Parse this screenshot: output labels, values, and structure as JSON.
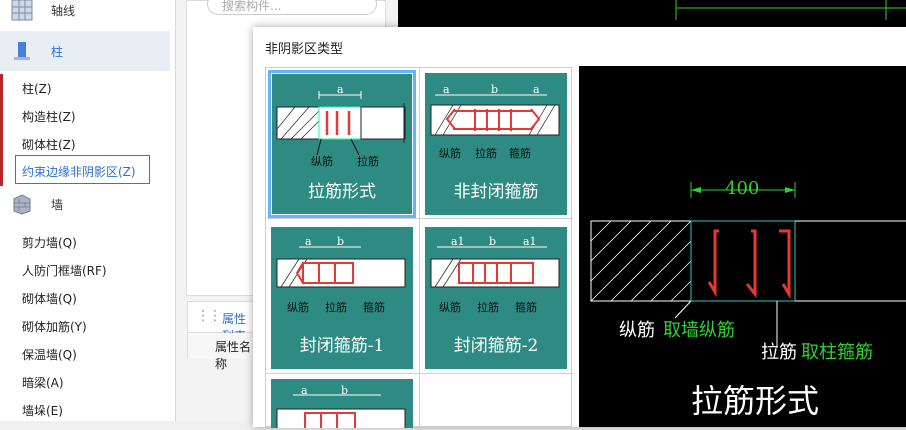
{
  "sidebar": {
    "categories": [
      {
        "label": "轴线",
        "icon": "grid-axis-icon"
      },
      {
        "label": "柱",
        "icon": "column-icon"
      },
      {
        "label": "墙",
        "icon": "wall-icon"
      }
    ],
    "column_items": [
      "柱(Z)",
      "构造柱(Z)",
      "砌体柱(Z)",
      "约束边缘非阴影区(Z)"
    ],
    "wall_items": [
      "剪力墙(Q)",
      "人防门框墙(RF)",
      "砌体墙(Q)",
      "砌体加筋(Y)",
      "保温墙(Q)",
      "暗梁(A)",
      "墙垛(E)"
    ]
  },
  "middle": {
    "search_placeholder": "搜索构件...",
    "props_tab": "属性列表",
    "props_header": "属性名称"
  },
  "dialog": {
    "title": "非阴影区类型",
    "tiles": [
      {
        "caption": "拉筋形式",
        "dims": [
          "a"
        ],
        "labels": [
          "纵筋",
          "拉筋"
        ],
        "selected": true
      },
      {
        "caption": "非封闭箍筋",
        "dims": [
          "a",
          "b",
          "a"
        ],
        "labels": [
          "纵筋",
          "拉筋",
          "箍筋"
        ]
      },
      {
        "caption": "封闭箍筋-1",
        "dims": [
          "a",
          "b"
        ],
        "labels": [
          "纵筋",
          "拉筋",
          "箍筋"
        ]
      },
      {
        "caption": "封闭箍筋-2",
        "dims": [
          "a1",
          "b",
          "a1"
        ],
        "labels": [
          "纵筋",
          "拉筋",
          "箍筋"
        ]
      },
      {
        "caption": "",
        "dims": [
          "a",
          "b"
        ],
        "labels": []
      }
    ],
    "preview": {
      "dimension": "400",
      "label_longbar": "纵筋",
      "label_longbar_note": "取墙纵筋",
      "label_tie": "拉筋",
      "label_tie_note": "取柱箍筋",
      "caption": "拉筋形式"
    }
  },
  "colors": {
    "tile_bg": "#2e8b83",
    "accent_blue": "#2d6fd2",
    "highlight_red": "#e53935",
    "cad_green": "#2fd12f",
    "cad_cyan": "#27c7c7"
  }
}
